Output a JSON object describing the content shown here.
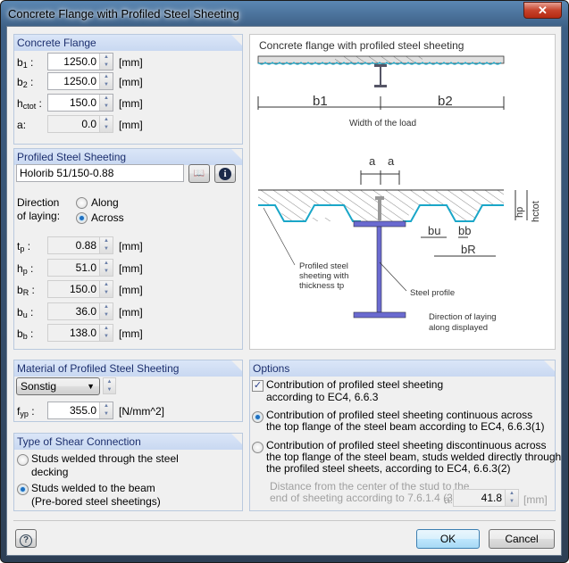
{
  "window": {
    "title": "Concrete Flange with Profiled Steel Sheeting",
    "close": "✕"
  },
  "concrete_flange": {
    "header": "Concrete Flange",
    "unit": "[mm]",
    "fields": [
      {
        "label": "b",
        "sub": "1",
        "suffix": " :",
        "value": "1250.0"
      },
      {
        "label": "b",
        "sub": "2",
        "suffix": " :",
        "value": "1250.0"
      },
      {
        "label": "h",
        "sub": "ctot",
        "suffix": " :",
        "value": "150.0"
      },
      {
        "label": "a",
        "sub": "",
        "suffix": ":",
        "value": "0.0"
      }
    ]
  },
  "sheeting": {
    "header": "Profiled Steel Sheeting",
    "name": "Holorib 51/150-0.88",
    "direction_label": "Direction of laying:",
    "along": "Along",
    "across": "Across",
    "direction": "Across",
    "unit": "[mm]",
    "fields": [
      {
        "label": "t",
        "sub": "p",
        "value": "0.88"
      },
      {
        "label": "h",
        "sub": "p",
        "value": "51.0"
      },
      {
        "label": "b",
        "sub": "R",
        "value": "150.0"
      },
      {
        "label": "b",
        "sub": "u",
        "value": "36.0"
      },
      {
        "label": "b",
        "sub": "b",
        "value": "138.0"
      }
    ]
  },
  "diagram": {
    "title": "Concrete flange with profiled steel sheeting",
    "b1": "b1",
    "b2": "b2",
    "width_label": "Width of the load",
    "a": "a",
    "bu": "bu",
    "bb": "bb",
    "bR": "bR",
    "hp": "hp",
    "hctot": "hctot",
    "sheeting_label": [
      "Profiled steel",
      "sheeting with",
      "thickness tp"
    ],
    "steel_label": "Steel profile",
    "direction_note": [
      "Direction of laying",
      "along displayed"
    ],
    "colors": {
      "sheet": "#1aa6c8",
      "steel": "#6a6ad0"
    }
  },
  "material": {
    "header": "Material of Profiled Steel Sheeting",
    "selected": "Sonstig",
    "fyp_label": "f",
    "fyp_sub": "yp",
    "fyp_value": "355.0",
    "fyp_unit": "[N/mm^2]"
  },
  "shear": {
    "header": "Type of Shear Connection",
    "options": [
      "Studs welded through the steel decking",
      "Studs welded to the beam (Pre-bored steel sheetings)"
    ],
    "option_lines": [
      [
        "Studs welded through the steel",
        "decking"
      ],
      [
        "Studs welded to the beam",
        "(Pre-bored steel sheetings)"
      ]
    ],
    "selected": 1
  },
  "options": {
    "header": "Options",
    "checkbox": [
      "Contribution of profiled steel sheeting",
      "according to EC4, 6.6.3"
    ],
    "checked": true,
    "radio1": [
      "Contribution of profiled steel sheeting continuous across",
      "the top flange of the steel beam according to EC4, 6.6.3(1)"
    ],
    "radio2": [
      "Contribution of profiled steel sheeting discontinuous across",
      "the top flange of the steel beam, studs welded directly through",
      "the profiled steel sheets, according to EC4, 6.6.3(2)"
    ],
    "selected": 1,
    "distance_label": [
      "Distance from the center of the stud to the",
      "end of sheeting according to 7.6.1.4 (3)"
    ],
    "a_label": "a:",
    "a_value": "41.8",
    "a_unit": "[mm]"
  },
  "buttons": {
    "help": "?",
    "ok": "OK",
    "cancel": "Cancel"
  }
}
